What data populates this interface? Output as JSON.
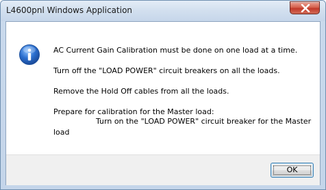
{
  "window": {
    "title": "L4600pnl Windows Application",
    "close_icon": "close-icon"
  },
  "dialog": {
    "icon": "info-icon",
    "lines": [
      "AC Current Gain Calibration must be done on one load at a time.",
      "Turn off the \"LOAD POWER\" circuit breakers on all the loads.",
      "Remove the Hold Off cables from all the loads.",
      "Prepare for calibration for the Master load:",
      "Turn on the \"LOAD POWER\" circuit breaker for the Master",
      "load"
    ],
    "ok_label": "OK"
  },
  "colors": {
    "info_icon_blue": "#2b6fcf",
    "close_button_red": "#c1392a",
    "ok_border": "#3c7fb1"
  }
}
